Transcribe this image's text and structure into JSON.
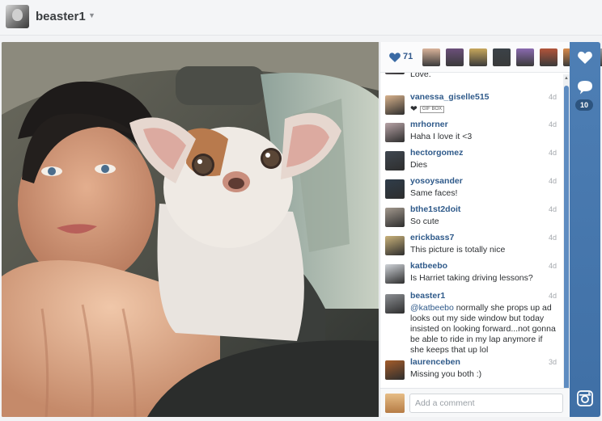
{
  "header": {
    "username": "beaster1",
    "avatar_icon": "user-avatar",
    "caret_icon": "caret-down-icon"
  },
  "likes": {
    "count": "71",
    "icon": "heart-icon",
    "liker_colors": [
      "#d9b39a",
      "#6b4f7a",
      "#c7a75c",
      "#3b4248",
      "#8a6ab0",
      "#b2543a",
      "#d88a4b",
      "#9a9fa5"
    ]
  },
  "comments": [
    {
      "user": "",
      "time": "",
      "text": "Love.",
      "avatar_color": "#a89aa6"
    },
    {
      "user": "vanessa_giselle515",
      "time": "4d",
      "text": "❤",
      "badge": "GIF BOX",
      "avatar_color": "#d8b28c"
    },
    {
      "user": "mrhorner",
      "time": "4d",
      "text": "Haha I love it <3",
      "avatar_color": "#b7a3a6"
    },
    {
      "user": "hectorgomez",
      "time": "4d",
      "text": "Dies",
      "avatar_color": "#3f4750"
    },
    {
      "user": "yosoysander",
      "time": "4d",
      "text": "Same faces!",
      "avatar_color": "#2f3d4a"
    },
    {
      "user": "bthe1st2doit",
      "time": "4d",
      "text": "So cute",
      "avatar_color": "#a3998e"
    },
    {
      "user": "erickbass7",
      "time": "4d",
      "text": "This picture is totally nice",
      "avatar_color": "#c9b27a"
    },
    {
      "user": "katbeebo",
      "time": "4d",
      "text": "Is Harriet taking driving lessons?",
      "avatar_color": "#cfd3d8"
    },
    {
      "user": "beaster1",
      "time": "4d",
      "mention": "@katbeebo",
      "text": " normally she props up ad looks out my side window but today insisted on looking forward...not gonna be able to ride in my lap anymore if she keeps that up lol",
      "avatar_color": "#8c8f93"
    },
    {
      "user": "laurenceben",
      "time": "3d",
      "text": "Missing you both :)",
      "avatar_color": "#a45c2a"
    }
  ],
  "composer": {
    "placeholder": "Add a comment"
  },
  "rail": {
    "comment_count": "10",
    "like_icon": "heart-icon",
    "comment_icon": "speech-bubble-icon",
    "camera_icon": "instagram-camera-icon"
  },
  "colors": {
    "accent": "#4a7bb0",
    "username_link": "#2f5a8a"
  }
}
